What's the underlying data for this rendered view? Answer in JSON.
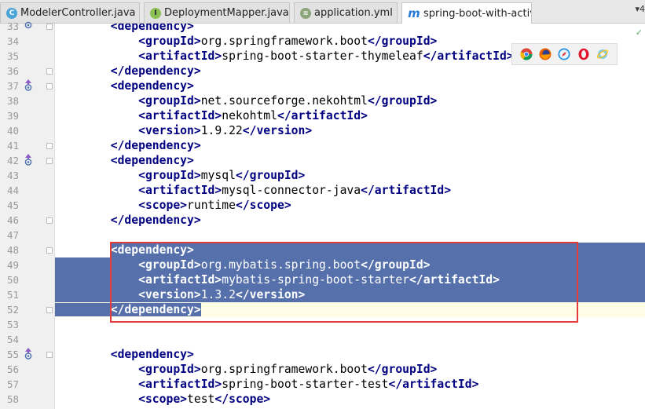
{
  "tabs": [
    {
      "label": "ModelerController.java",
      "icon": "class-icon",
      "icon_letter": "C",
      "close": "×",
      "active": false
    },
    {
      "label": "DeploymentMapper.java",
      "icon": "interface-icon",
      "icon_letter": "I",
      "close": "×",
      "active": false
    },
    {
      "label": "application.yml",
      "icon": "yml-file-icon",
      "icon_letter": "≋",
      "close": "×",
      "active": false
    },
    {
      "label": "spring-boot-with-activiti",
      "icon": "maven-icon",
      "icon_letter": "m",
      "close": "",
      "active": true
    }
  ],
  "tab_overflow": "▾4",
  "gutter": {
    "line_numbers": [
      "33",
      "34",
      "35",
      "36",
      "37",
      "38",
      "39",
      "40",
      "41",
      "42",
      "43",
      "44",
      "45",
      "46",
      "47",
      "48",
      "49",
      "50",
      "51",
      "52",
      "53",
      "54",
      "55",
      "56",
      "57",
      "58"
    ]
  },
  "code": {
    "l33": {
      "indent": "        ",
      "tag_open": "<dependency>"
    },
    "l34": {
      "indent": "            ",
      "t1": "<groupId>",
      "text": "org.springframework.boot",
      "t2": "</groupId>"
    },
    "l35": {
      "indent": "            ",
      "t1": "<artifactId>",
      "text": "spring-boot-starter-thymeleaf",
      "t2": "</artifactId>"
    },
    "l36": {
      "indent": "        ",
      "tag_close": "</dependency>"
    },
    "l37": {
      "indent": "        ",
      "tag_open": "<dependency>"
    },
    "l38": {
      "indent": "            ",
      "t1": "<groupId>",
      "text": "net.sourceforge.nekohtml",
      "t2": "</groupId>"
    },
    "l39": {
      "indent": "            ",
      "t1": "<artifactId>",
      "text": "nekohtml",
      "t2": "</artifactId>"
    },
    "l40": {
      "indent": "            ",
      "t1": "<version>",
      "text": "1.9.22",
      "t2": "</version>"
    },
    "l41": {
      "indent": "        ",
      "tag_close": "</dependency>"
    },
    "l42": {
      "indent": "        ",
      "tag_open": "<dependency>"
    },
    "l43": {
      "indent": "            ",
      "t1": "<groupId>",
      "text": "mysql",
      "t2": "</groupId>"
    },
    "l44": {
      "indent": "            ",
      "t1": "<artifactId>",
      "text": "mysql-connector-java",
      "t2": "</artifactId>"
    },
    "l45": {
      "indent": "            ",
      "t1": "<scope>",
      "text": "runtime",
      "t2": "</scope>"
    },
    "l46": {
      "indent": "        ",
      "tag_close": "</dependency>"
    },
    "l48": {
      "indent": "        ",
      "tag_open": "<dependency>"
    },
    "l49": {
      "indent": "            ",
      "t1": "<groupId>",
      "text": "org.mybatis.spring.boot",
      "t2": "</groupId>"
    },
    "l50": {
      "indent": "            ",
      "t1": "<artifactId>",
      "text": "mybatis-spring-boot-starter",
      "t2": "</artifactId>"
    },
    "l51": {
      "indent": "            ",
      "t1": "<version>",
      "text": "1.3.2",
      "t2": "</version>"
    },
    "l52": {
      "indent": "        ",
      "tag_close": "</dependency>"
    },
    "l55": {
      "indent": "        ",
      "tag_open": "<dependency>"
    },
    "l56": {
      "indent": "            ",
      "t1": "<groupId>",
      "text": "org.springframework.boot",
      "t2": "</groupId>"
    },
    "l57": {
      "indent": "            ",
      "t1": "<artifactId>",
      "text": "spring-boot-starter-test",
      "t2": "</artifactId>"
    },
    "l58": {
      "indent": "            ",
      "t1": "<scope>",
      "text": "test",
      "t2": "</scope>"
    }
  },
  "browser_icons": [
    "chrome-icon",
    "firefox-icon",
    "safari-icon",
    "opera-icon",
    "ie-icon"
  ],
  "colors": {
    "selection": "#5570aa",
    "tag": "#000080",
    "highlight_box": "#e53b3b"
  }
}
